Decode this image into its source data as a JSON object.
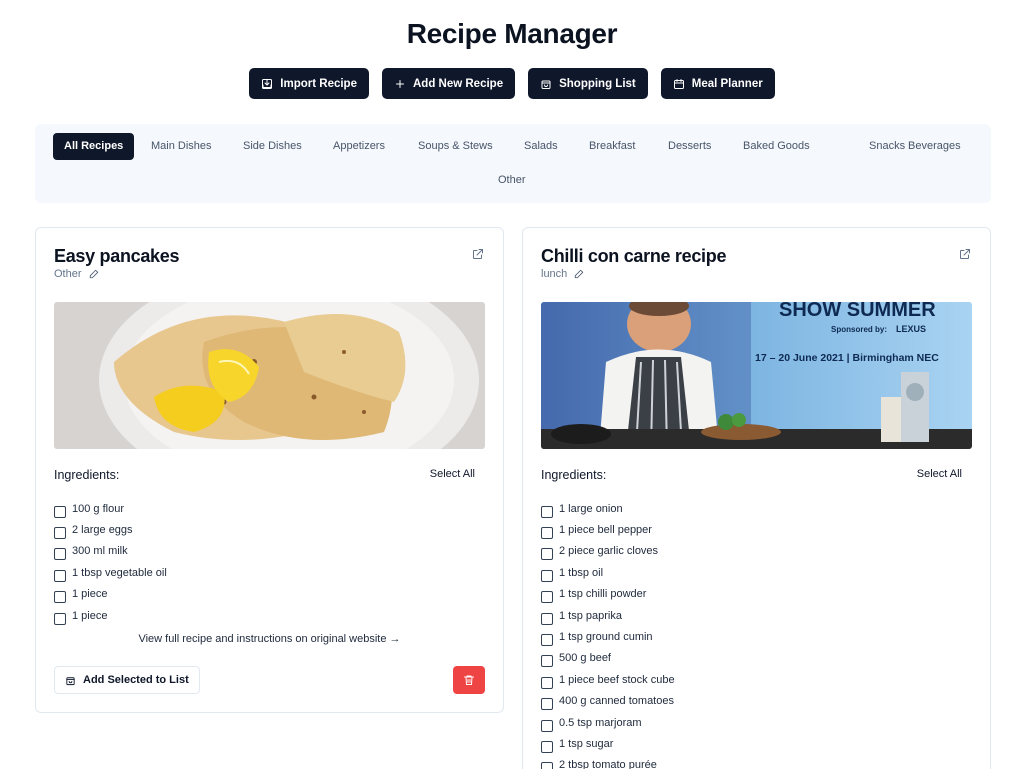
{
  "page": {
    "title": "Recipe Manager"
  },
  "actions": {
    "import": "Import Recipe",
    "add": "Add New Recipe",
    "shopping": "Shopping List",
    "planner": "Meal Planner"
  },
  "categories": {
    "active": "All Recipes",
    "items": [
      "All Recipes",
      "Main Dishes",
      "Side Dishes",
      "Appetizers",
      "Soups & Stews",
      "Salads",
      "Breakfast",
      "Desserts",
      "Baked Goods",
      "Snacks",
      "Beverages",
      "Other"
    ]
  },
  "colors": {
    "primary": "#0f172a",
    "danger": "#ef4444",
    "category_bar": "#f5f8fc",
    "border": "#e2e8f0"
  },
  "common": {
    "ingredients_heading": "Ingredients:",
    "select_all": "Select All",
    "add_selected": "Add Selected to List",
    "view_full_recipe": "View full recipe and instructions on original website →"
  },
  "recipes": [
    {
      "title": "Easy pancakes",
      "category": "Other",
      "image": "pancakes-photo",
      "ingredients": [
        "100 g flour",
        "2 large eggs",
        "300 ml milk",
        "1 tbsp vegetable oil",
        "1 piece",
        "1 piece"
      ]
    },
    {
      "title": "Chilli con carne recipe",
      "category": "lunch",
      "image": "chef-at-food-show-photo",
      "image_text": {
        "show": "SHOW SUMMER",
        "sponsor": "Sponsored by:",
        "sponsor_brand": "LEXUS",
        "dates": "17 – 20 June 2021 | Birmingham NEC"
      },
      "ingredients": [
        "1 large onion",
        "1 piece bell pepper",
        "2 piece garlic cloves",
        "1 tbsp oil",
        "1 tsp chilli powder",
        "1 tsp paprika",
        "1 tsp ground cumin",
        "500 g beef",
        "1 piece beef stock cube",
        "400 g canned tomatoes",
        "0.5 tsp marjoram",
        "1 tsp sugar",
        "2 tbsp tomato purée"
      ]
    }
  ]
}
